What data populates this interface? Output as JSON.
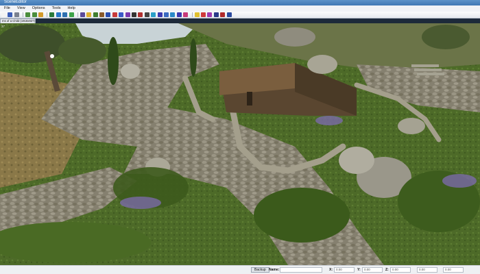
{
  "window": {
    "title": "SceneEditor"
  },
  "menu": {
    "items": [
      "File",
      "View",
      "Options",
      "Tools",
      "Help"
    ]
  },
  "toolbar": {
    "tools": [
      {
        "name": "new-icon",
        "color": "#f4f4f4"
      },
      {
        "name": "save-icon",
        "color": "#3b5fb8"
      },
      {
        "name": "cut-icon",
        "color": "#7a8190"
      },
      {
        "name": "sep"
      },
      {
        "name": "undo-icon",
        "color": "#4a8d3c"
      },
      {
        "name": "redo-icon",
        "color": "#4a8d3c"
      },
      {
        "name": "zoom-icon",
        "color": "#d39a2a"
      },
      {
        "name": "sep"
      },
      {
        "name": "terrain-icon",
        "color": "#2a7a3a"
      },
      {
        "name": "water-icon",
        "color": "#2878c8"
      },
      {
        "name": "path-icon",
        "color": "#2d6fb0"
      },
      {
        "name": "grass-icon",
        "color": "#3ca34a"
      },
      {
        "name": "sep"
      },
      {
        "name": "object-icon",
        "color": "#5b4a9a"
      },
      {
        "name": "light-icon",
        "color": "#e0b030"
      },
      {
        "name": "tree-icon",
        "color": "#3f7d2f"
      },
      {
        "name": "rock-icon",
        "color": "#8a5a2a"
      },
      {
        "name": "ai-icon",
        "color": "#2a4fb0"
      },
      {
        "name": "npc-icon",
        "color": "#c83a3a"
      },
      {
        "name": "marker-icon",
        "color": "#3a5ac8"
      },
      {
        "name": "trigger-icon",
        "color": "#7a3ab0"
      },
      {
        "name": "pencil-icon",
        "color": "#333333"
      },
      {
        "name": "paint-icon",
        "color": "#b03030"
      },
      {
        "name": "camera-icon",
        "color": "#444444"
      },
      {
        "name": "grid-icon",
        "color": "#2aa0c8"
      },
      {
        "name": "measure-icon",
        "color": "#3a3ab0"
      },
      {
        "name": "waypoint-icon",
        "color": "#3a6ac0"
      },
      {
        "name": "region-icon",
        "color": "#2a8ac8"
      },
      {
        "name": "sound-icon",
        "color": "#3a3ab0"
      },
      {
        "name": "spawn-icon",
        "color": "#c83a7a"
      },
      {
        "name": "sep"
      },
      {
        "name": "bulb-icon",
        "color": "#e0c030"
      },
      {
        "name": "heart-icon",
        "color": "#d03a3a"
      },
      {
        "name": "flag-icon",
        "color": "#a03ab0"
      },
      {
        "name": "settings-icon",
        "color": "#2a3a8a"
      },
      {
        "name": "shield-icon",
        "color": "#b02a2a"
      },
      {
        "name": "info-icon",
        "color": "#2a4aa0"
      }
    ]
  },
  "document_tab": {
    "label": "ms of a Child (1918x927)"
  },
  "viewport": {
    "coords": "37"
  },
  "statusbar": {
    "backup_label": "Backup",
    "name_label": "Name:",
    "x_label": "X:",
    "y_label": "Y:",
    "z_label": "Z:",
    "x_value": "0.00",
    "y_value": "0.00",
    "z_value": "0.00",
    "extra_value_1": "0.00",
    "extra_value_2": "0.00"
  },
  "colors": {
    "titlebar": "#4a82bf",
    "grass": "#4f6b2b",
    "stone": "#8a8778"
  }
}
